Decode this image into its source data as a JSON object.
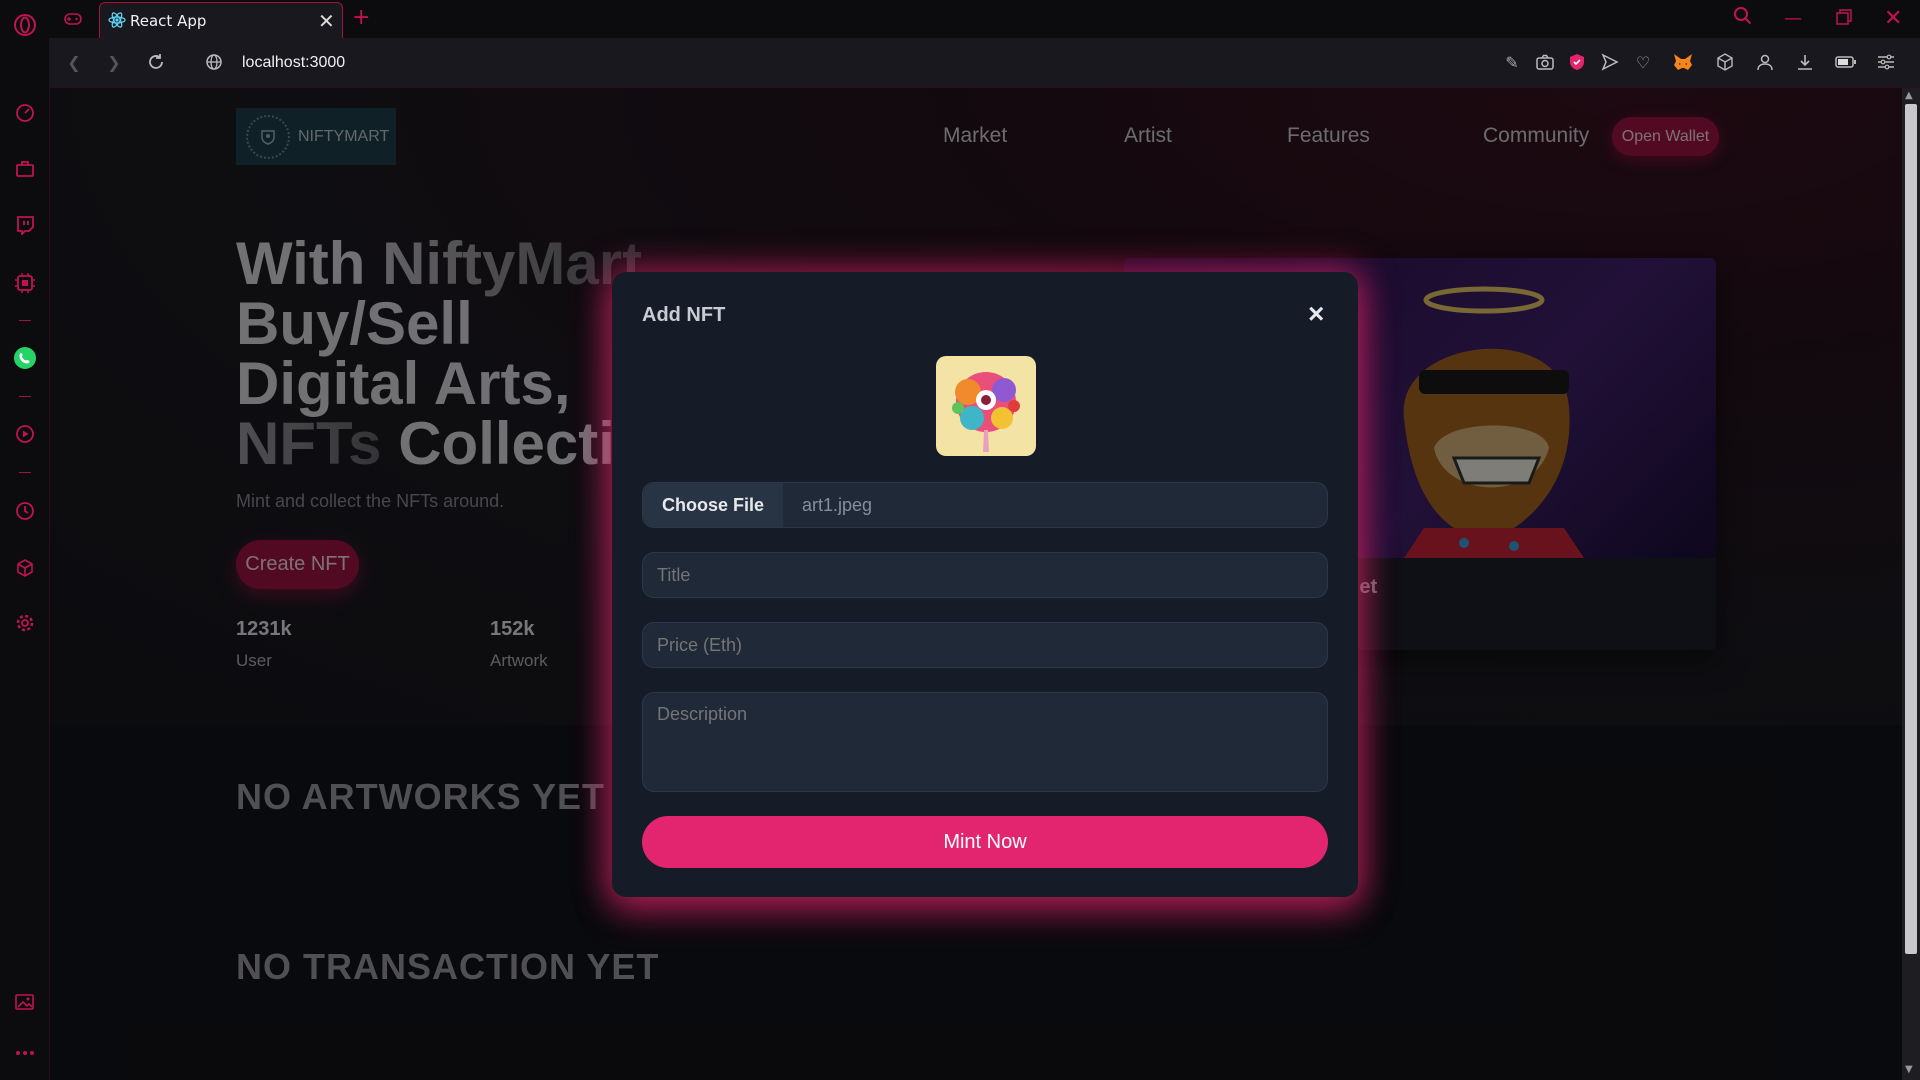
{
  "browser": {
    "tab_title": "React App",
    "url": "localhost:3000",
    "sidebar_icons": [
      "opera-logo-icon",
      "speed-dial-icon",
      "briefcase-icon",
      "twitch-icon",
      "chip-icon",
      "whatsapp-icon",
      "play-icon",
      "history-icon",
      "cube-icon",
      "settings-icon",
      "gallery-icon",
      "more-icon"
    ],
    "toolbar_icons": [
      "edit-icon",
      "camera-icon",
      "shield-icon",
      "send-icon",
      "heart-icon",
      "metamask-icon",
      "box-icon",
      "account-icon",
      "download-icon",
      "battery-icon",
      "menu-icon"
    ]
  },
  "site": {
    "logo_text": "NIFTYMART",
    "nav": [
      "Market",
      "Artist",
      "Features",
      "Community"
    ],
    "open_wallet": "Open Wallet",
    "hero": {
      "line1_a": "With ",
      "line1_b": "NiftyMart",
      "line2": "Buy/Sell",
      "line3": "Digital Arts,",
      "line4_a": "NFTs ",
      "line4_b": "Collecti",
      "subtitle": "Mint and collect the NFTs around.",
      "cta": "Create NFT"
    },
    "stats": [
      {
        "value": "1231k",
        "label": "User"
      },
      {
        "value": "152k",
        "label": "Artwork"
      }
    ],
    "card_caption": "Wallet",
    "no_artworks": "NO ARTWORKS YET",
    "no_transaction": "NO TRANSACTION YET"
  },
  "modal": {
    "title": "Add NFT",
    "close": "×",
    "choose_file": "Choose File",
    "file_name": "art1.jpeg",
    "title_placeholder": "Title",
    "price_placeholder": "Price (Eth)",
    "description_placeholder": "Description",
    "submit": "Mint Now"
  },
  "colors": {
    "accent": "#e3256f",
    "accent_dark": "#9e1443",
    "modal_bg": "#151c27"
  }
}
